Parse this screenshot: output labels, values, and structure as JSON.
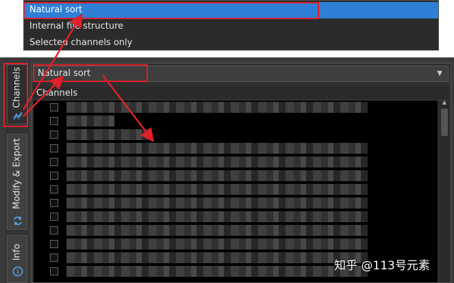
{
  "dropdown": {
    "items": [
      {
        "label": "Natural sort",
        "selected": true
      },
      {
        "label": "Internal file structure",
        "selected": false
      },
      {
        "label": "Selected channels only",
        "selected": false
      }
    ]
  },
  "tabs": [
    {
      "label": "Channels",
      "icon": "wave-icon",
      "active": true
    },
    {
      "label": "Modify & Export",
      "icon": "refresh-arrows-icon",
      "active": false
    },
    {
      "label": "Info",
      "icon": "info-icon",
      "active": false
    }
  ],
  "panel": {
    "sort_value": "Natural sort",
    "channels_header": "Channels"
  },
  "watermark": "知乎 @113号元素",
  "colors": {
    "highlight": "#e0202a",
    "selection": "#2f7fd6",
    "accent_icon": "#5aa0e8"
  }
}
